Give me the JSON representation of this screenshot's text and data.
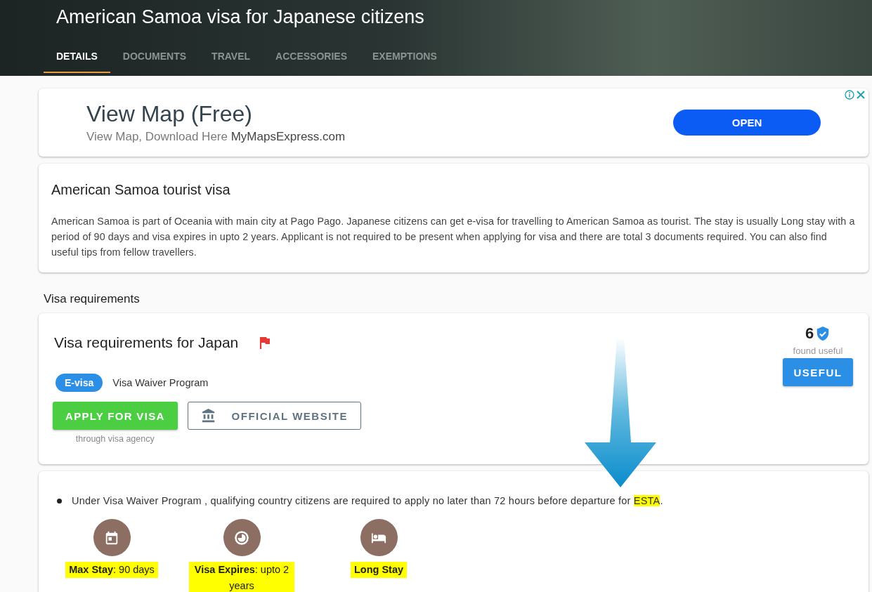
{
  "header": {
    "title": "American Samoa visa for Japanese citizens",
    "tabs": [
      {
        "label": "DETAILS",
        "selected": true
      },
      {
        "label": "DOCUMENTS",
        "selected": false
      },
      {
        "label": "TRAVEL",
        "selected": false
      },
      {
        "label": "ACCESSORIES",
        "selected": false
      },
      {
        "label": "EXEMPTIONS",
        "selected": false
      }
    ]
  },
  "ad": {
    "title": "View Map (Free)",
    "subtitle": "View Map, Download Here",
    "domain": "MyMapsExpress.com",
    "button": "OPEN"
  },
  "summary": {
    "title": "American Samoa tourist visa",
    "text": "American Samoa is part of Oceania with main city at Pago Pago. Japanese citizens can get e-visa for travelling to American Samoa as tourist. The stay is usually Long stay with a period of 90 days and visa expires in upto 2 years. Applicant is not required to be present when applying for visa and there are total 3 documents required. You can also find useful tips from fellow travellers."
  },
  "section_heading": "Visa requirements",
  "requirements": {
    "title": "Visa requirements for Japan",
    "badge": "E-visa",
    "program": "Visa Waiver Program",
    "apply_button": "APPLY FOR VISA",
    "apply_note": "through visa agency",
    "official_button": "OFFICIAL WEBSITE",
    "useful_count": "6",
    "useful_label": "found useful",
    "useful_button": "USEFUL"
  },
  "notes": [
    {
      "text": "Under Visa Waiver Program , qualifying country citizens are required to apply no later than 72 hours before departure for",
      "highlight": "ESTA",
      "end": "."
    }
  ],
  "stats": [
    {
      "kind": "calendar",
      "text": "**Max Stay**: 90 days"
    },
    {
      "kind": "clock",
      "text": "**Visa Expires**: upto 2 years"
    },
    {
      "kind": "bed",
      "text": "**Long Stay**"
    }
  ]
}
